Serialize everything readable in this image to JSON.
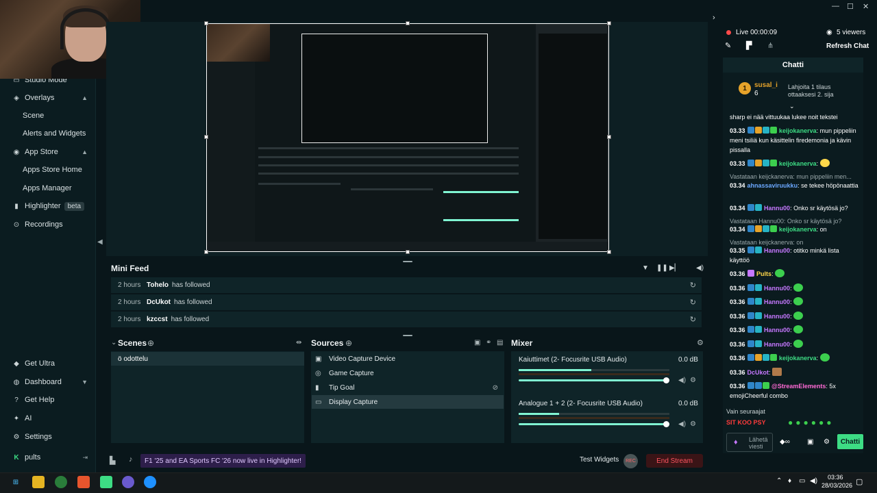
{
  "window": {
    "minimize": "—",
    "maximize": "☐",
    "close": "✕"
  },
  "sidebar": {
    "items": [
      {
        "label": "Studio Mode"
      },
      {
        "label": "Overlays"
      },
      {
        "label": "Scene"
      },
      {
        "label": "Alerts and Widgets"
      },
      {
        "label": "App Store"
      },
      {
        "label": "Apps Store Home"
      },
      {
        "label": "Apps Manager"
      },
      {
        "label": "Highlighter",
        "badge": "beta"
      },
      {
        "label": "Recordings"
      },
      {
        "label": "Get Ultra"
      },
      {
        "label": "Dashboard"
      },
      {
        "label": "Get Help"
      },
      {
        "label": "AI"
      },
      {
        "label": "Settings"
      },
      {
        "label": "pults"
      }
    ]
  },
  "minifeed": {
    "title": "Mini Feed",
    "rows": [
      {
        "time": "2 hours",
        "name": "Tohelo",
        "action": "has followed"
      },
      {
        "time": "2 hours",
        "name": "DcUkot",
        "action": "has followed"
      },
      {
        "time": "2 hours",
        "name": "kzccst",
        "action": "has followed"
      }
    ]
  },
  "scenes": {
    "title": "Scenes",
    "items": [
      "ö odottelu"
    ]
  },
  "sources": {
    "title": "Sources",
    "items": [
      "Video Capture Device",
      "Game Capture",
      "Tip Goal",
      "Display Capture"
    ]
  },
  "mixer": {
    "title": "Mixer",
    "channels": [
      {
        "name": "Kaiuttimet (2- Focusrite USB Audio)",
        "db": "0.0 dB",
        "level": 0.85
      },
      {
        "name": "Analogue 1 + 2 (2- Focusrite USB Audio)",
        "db": "0.0 dB",
        "level": 0.85
      }
    ]
  },
  "bottombar": {
    "notification": "F1 '25 and EA Sports FC '26 now live in Highlighter!",
    "test_widgets": "Test Widgets",
    "rec": "REC",
    "end_stream": "End Stream"
  },
  "stream": {
    "live": "Live 00:00:09",
    "viewers": "5 viewers",
    "refresh": "Refresh Chat"
  },
  "chat": {
    "title": "Chatti",
    "sub_user": "susal_i",
    "sub_count": "6",
    "sub_text": "Lahjoita 1 tilaus ottaaksesi 2. sija",
    "messages": [
      {
        "line1": "sharp ei nää vittuukaa lukee noit tekstei"
      },
      {
        "time": "03.33",
        "user": "keijokanerva",
        "text": "mun pippeliin meni tsiliä kun käsittelin firedemonia ja kävin pissalla"
      },
      {
        "time": "03.33",
        "user": "keijokanerva",
        "text": ""
      },
      {
        "reply": "Vastataan keijckanerva: mun pippeliin men...",
        "time": "03.34",
        "user": "ahnassaviruukku",
        "text": "se tekee höpönaattia"
      },
      {
        "time": "03.34",
        "user": "Hannu00",
        "text": "Onko sr käytösä jo?"
      },
      {
        "reply": "Vastataan Hannu00: Onko sr käytösä jo?",
        "time": "03.34",
        "user": "keijokanerva",
        "text": "on"
      },
      {
        "reply": "Vastataan keijckanerva: on",
        "time": "03.35",
        "user": "Hannu00",
        "text": "otitko minkä lista käyttöö"
      },
      {
        "time": "03.36",
        "user": "Pults",
        "text": ""
      },
      {
        "time": "03.36",
        "user": "Hannu00",
        "text": ""
      },
      {
        "time": "03.36",
        "user": "Hannu00",
        "text": ""
      },
      {
        "time": "03.36",
        "user": "Hannu00",
        "text": ""
      },
      {
        "time": "03.36",
        "user": "Hannu00",
        "text": ""
      },
      {
        "time": "03.36",
        "user": "Hannu00",
        "text": ""
      },
      {
        "time": "03.36",
        "user": "keijokanerva",
        "text": ""
      },
      {
        "time": "03.36",
        "user": "DcUkot",
        "text": ""
      },
      {
        "time": "03.36",
        "user": "@StreamElements",
        "text": "5x emojiCheerful combo"
      }
    ],
    "follow_only": "Vain seuraajat",
    "follow_emotes": "SIT KOO PSY",
    "input_placeholder": "Lähetä viesti",
    "send": "Chatti"
  },
  "taskbar": {
    "time": "03:36",
    "date": "28/03/2026"
  },
  "accent": "#3ddc84"
}
